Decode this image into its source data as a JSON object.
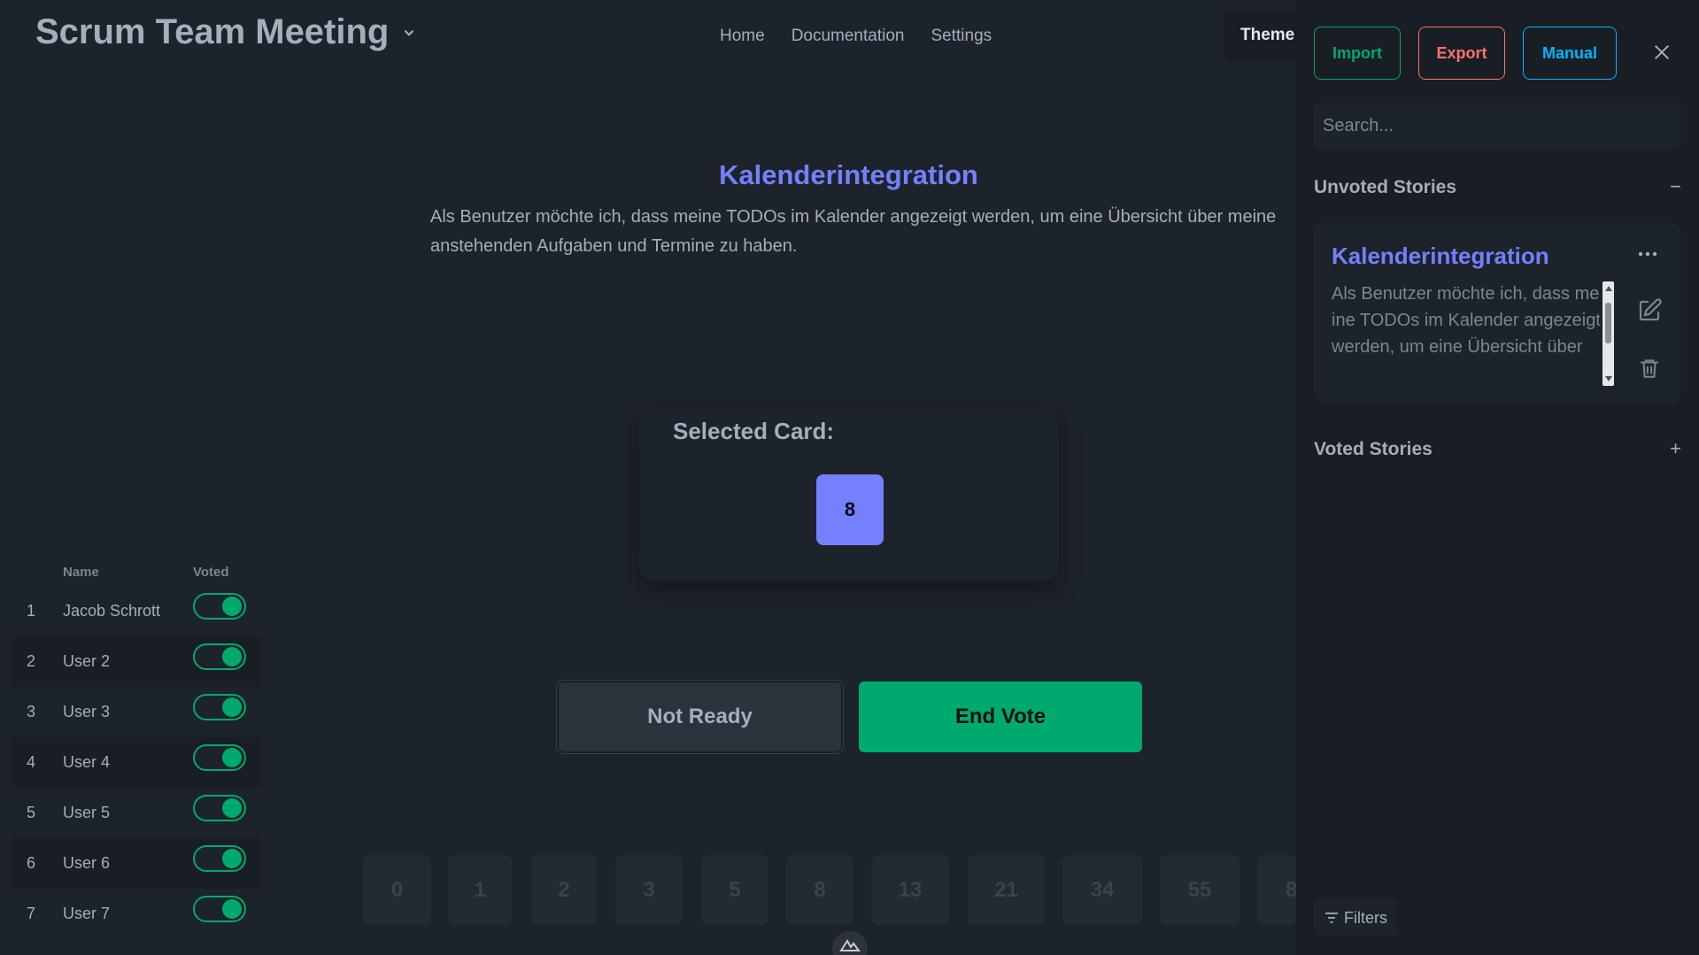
{
  "header": {
    "title": "Scrum Team Meeting",
    "nav": [
      "Home",
      "Documentation",
      "Settings"
    ],
    "theme_label": "Theme"
  },
  "story": {
    "title": "Kalenderintegration",
    "description": "Als Benutzer möchte ich, dass meine TODOs im Kalender angezeigt werden, um eine Übersicht über meine anstehenden Aufgaben und Termine zu haben."
  },
  "selection": {
    "label": "Selected Card:",
    "value": "8"
  },
  "actions": {
    "not_ready": "Not Ready",
    "end_vote": "End Vote"
  },
  "deck": [
    "0",
    "1",
    "2",
    "3",
    "5",
    "8",
    "13",
    "21",
    "34",
    "55",
    "8"
  ],
  "participants": {
    "col_name": "Name",
    "col_voted": "Voted",
    "rows": [
      {
        "num": "1",
        "name": "Jacob Schrott",
        "voted": true
      },
      {
        "num": "2",
        "name": "User 2",
        "voted": true
      },
      {
        "num": "3",
        "name": "User 3",
        "voted": true
      },
      {
        "num": "4",
        "name": "User 4",
        "voted": true
      },
      {
        "num": "5",
        "name": "User 5",
        "voted": true
      },
      {
        "num": "6",
        "name": "User 6",
        "voted": true
      },
      {
        "num": "7",
        "name": "User 7",
        "voted": true
      }
    ]
  },
  "drawer": {
    "import_label": "Import",
    "export_label": "Export",
    "manual_label": "Manual",
    "search_placeholder": "Search...",
    "unvoted_heading": "Unvoted Stories",
    "unvoted_sign": "−",
    "voted_heading": "Voted Stories",
    "voted_sign": "+",
    "filters_label": "Filters",
    "story_card": {
      "title": "Kalenderintegration",
      "description": "Als Benutzer möchte ich, dass meine TODOs im Kalender angezeigt werden, um eine Übersicht über"
    }
  },
  "colors": {
    "background": "#1d232a",
    "drawer": "#191e24",
    "primary": "#7480ff",
    "success": "#00a96e",
    "error": "#f87272",
    "info": "#00b5ff"
  }
}
